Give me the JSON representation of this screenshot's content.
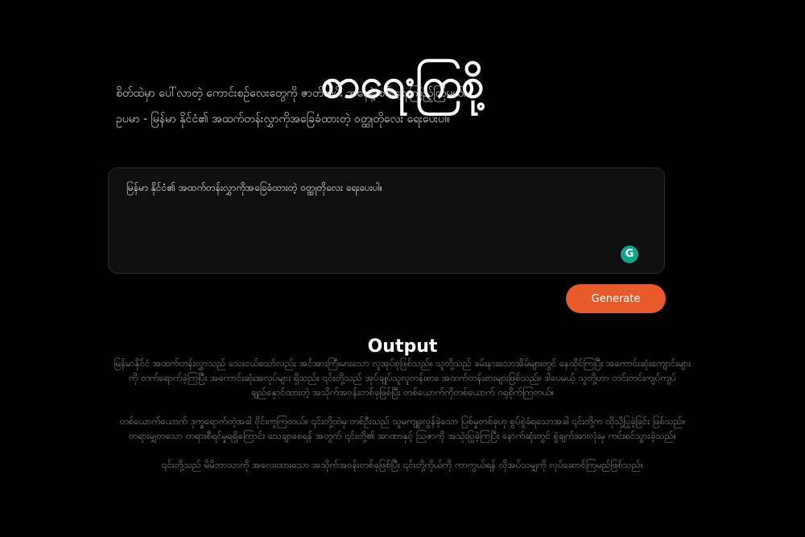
{
  "header": {
    "title": "စာရေးကြစို့",
    "subtitle_line1": "စိတ်ထဲမှာ ပေါ်လာတဲ့ ကောင်းစဉ်လေးတွေကို ဇာတ်လမ်း အနေနဲ့ စမ်းရေးကြည့်ကြမယ်။",
    "subtitle_line2": "ဥပမာ - မြန်မာ နိုင်ငံ၏ အထက်တန်းလွှာကိုအခြေခံထားတဲ့ ဝတ္ထုတိုလေး ရေးပေးပါ။"
  },
  "prompt": {
    "value": "မြန်မာ နိုင်ငံ၏ အထက်တန်းလွှာကိုအခြေခံထားတဲ့ ဝတ္ထုတိုလေး ရေးပေးပါ။",
    "grammarly_letter": "G"
  },
  "actions": {
    "generate_label": "Generate"
  },
  "output": {
    "heading": "Output",
    "paragraphs": [
      "မြန်မာနိုင်ငံ အထက်တန်းလွှာသည် သေးငယ်သော်လည်း အင်အားကြီးမားသော လူအုပ်စုဖြစ်သည်။ သူတို့သည် ခမ်းနားသောအိမ်များတွင် နေထိုင်ကြပြီး အကောင်းဆုံးကျောင်းများကို တက်ရောက်ခဲ့ကြပြီး အကောင်းဆုံးအလုပ်များ ရှိသည်။ ၎င်းတို့သည် အုပ်ချုပ်သူလူတန်းစား၊ အထက်တန်းစားများဖြစ်သည်။ ဒါပေမယ့် သူတို့ဟာ တင်းတင်းကျပ်ကျပ် ချည်နှောင်ထားတဲ့ အသိုက်အဝန်းတစ်ခုဖြစ်ပြီး တစ်ယောက်ကိုတစ်ယောက် ဂရုစိုက်ကြတယ်။",
      "တစ်ယောက်ယောက် ဒုက္ခရောက်တဲ့အခါ ဝိုင်းကူကြတယ်။ ၎င်းတို့ထဲမှ တစ်ဦးသည် သူမကျူးလွန်ခဲ့သော ပြစ်မှုတစ်ခုဟု စွပ်စွဲခံရသောအခါ ၎င်းတို့က ထိုသို့ပြုခဲ့ခြင်း ဖြစ်သည်။ တရားမျှတသော တရားစီရင်မှုရရှိကြောင်း သေချာစေရန် အတွက် ၎င်းတို့၏ အာဏာနှင့် ဩဇာကို အသုံးပြုခဲ့ကြပြီး နောက်ဆုံးတွင် စွဲချက်အားလုံးမှ ကင်းစင်သွားခဲ့သည်။",
      "၎င်းတို့သည် မိမိဘာသာကို အလေးထားသော အသိုက်အဝန်းတစ်ခုဖြစ်ပြီး ၎င်းတို့ကိုယ်ကို ကာကွယ်ရန် လိုအပ်သမျှကို လုပ်ဆောင်ကြမည်ဖြစ်သည်။"
    ]
  },
  "colors": {
    "background": "#000000",
    "accent": "#e85a2c",
    "grammarly": "#14a38b"
  }
}
